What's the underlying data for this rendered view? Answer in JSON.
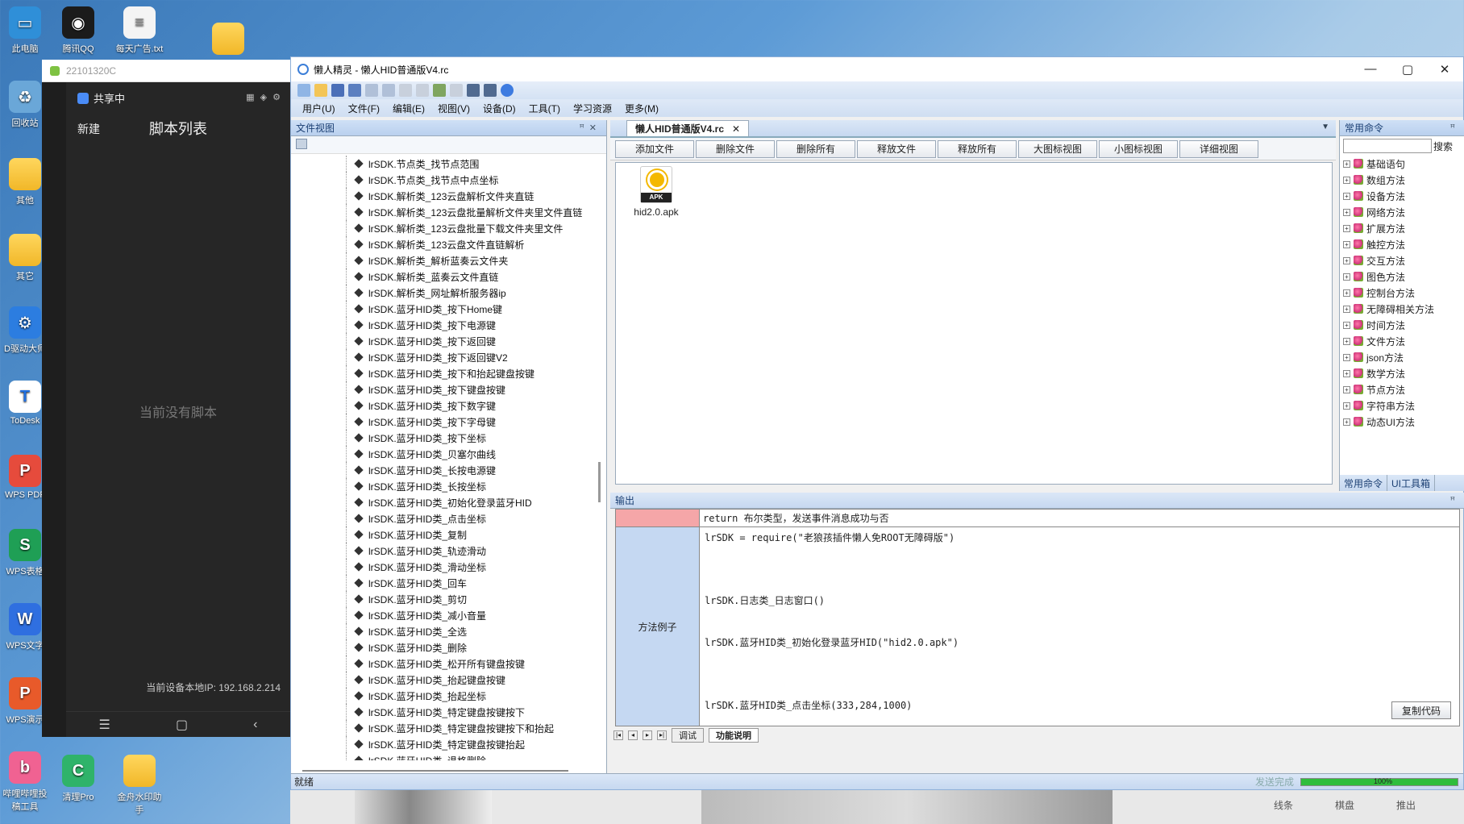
{
  "desktop": {
    "icons_left": [
      {
        "label": "此电脑"
      },
      {
        "label": "回收站"
      },
      {
        "label": "其他"
      },
      {
        "label": "其它"
      },
      {
        "label": "D驱动大师"
      },
      {
        "label": "ToDesk"
      },
      {
        "label": "WPS PDF"
      },
      {
        "label": "WPS表格"
      },
      {
        "label": "WPS文字"
      },
      {
        "label": "WPS演示"
      },
      {
        "label": "哔哩哔哩投稿工具"
      }
    ],
    "icons_top": [
      {
        "label": "腾讯QQ"
      },
      {
        "label": "每天广告.txt"
      }
    ],
    "icons_bottom": [
      {
        "label": "清理Pro"
      },
      {
        "label": "金舟水印助手"
      }
    ]
  },
  "phone": {
    "window_title": "22101320C",
    "share_status": "共享中",
    "new_label": "新建",
    "list_title": "脚本列表",
    "empty_text": "当前没有脚本",
    "ip_text": "当前设备本地IP: 192.168.2.214"
  },
  "app": {
    "title": "懒人精灵 - 懒人HID普通版V4.rc",
    "menu": [
      "用户(U)",
      "文件(F)",
      "编辑(E)",
      "视图(V)",
      "设备(D)",
      "工具(T)",
      "学习资源",
      "更多(M)"
    ],
    "file_view_title": "文件视图",
    "tree_items": [
      "lrSDK.节点类_找节点范围",
      "lrSDK.节点类_找节点中点坐标",
      "lrSDK.解析类_123云盘解析文件夹直链",
      "lrSDK.解析类_123云盘批量解析文件夹里文件直链",
      "lrSDK.解析类_123云盘批量下载文件夹里文件",
      "lrSDK.解析类_123云盘文件直链解析",
      "lrSDK.解析类_解析蓝奏云文件夹",
      "lrSDK.解析类_蓝奏云文件直链",
      "lrSDK.解析类_网址解析服务器ip",
      "lrSDK.蓝牙HID类_按下Home键",
      "lrSDK.蓝牙HID类_按下电源键",
      "lrSDK.蓝牙HID类_按下返回键",
      "lrSDK.蓝牙HID类_按下返回键V2",
      "lrSDK.蓝牙HID类_按下和抬起键盘按键",
      "lrSDK.蓝牙HID类_按下键盘按键",
      "lrSDK.蓝牙HID类_按下数字键",
      "lrSDK.蓝牙HID类_按下字母键",
      "lrSDK.蓝牙HID类_按下坐标",
      "lrSDK.蓝牙HID类_贝塞尔曲线",
      "lrSDK.蓝牙HID类_长按电源键",
      "lrSDK.蓝牙HID类_长按坐标",
      "lrSDK.蓝牙HID类_初始化登录蓝牙HID",
      "lrSDK.蓝牙HID类_点击坐标",
      "lrSDK.蓝牙HID类_复制",
      "lrSDK.蓝牙HID类_轨迹滑动",
      "lrSDK.蓝牙HID类_滑动坐标",
      "lrSDK.蓝牙HID类_回车",
      "lrSDK.蓝牙HID类_剪切",
      "lrSDK.蓝牙HID类_减小音量",
      "lrSDK.蓝牙HID类_全选",
      "lrSDK.蓝牙HID类_删除",
      "lrSDK.蓝牙HID类_松开所有键盘按键",
      "lrSDK.蓝牙HID类_抬起键盘按键",
      "lrSDK.蓝牙HID类_抬起坐标",
      "lrSDK.蓝牙HID类_特定键盘按键按下",
      "lrSDK.蓝牙HID类_特定键盘按键按下和抬起",
      "lrSDK.蓝牙HID类_特定键盘按键抬起",
      "lrSDK.蓝牙HID类_退格删除"
    ],
    "doc_tab": "懒人HID普通版V4.rc",
    "file_buttons": [
      "添加文件",
      "删除文件",
      "删除所有",
      "释放文件",
      "释放所有",
      "大图标视图",
      "小图标视图",
      "详细视图"
    ],
    "file_item": {
      "name": "hid2.0.apk",
      "badge": "APK"
    },
    "cmd_title": "常用命令",
    "cmd_search": "搜索",
    "commands": [
      "基础语句",
      "数组方法",
      "设备方法",
      "网络方法",
      "扩展方法",
      "触控方法",
      "交互方法",
      "图色方法",
      "控制台方法",
      "无障碍相关方法",
      "时间方法",
      "文件方法",
      "json方法",
      "数学方法",
      "节点方法",
      "字符串方法",
      "动态UI方法"
    ],
    "cmd_tabs": [
      "常用命令",
      "UI工具箱"
    ],
    "output_title": "输出",
    "output_return": "return 布尔类型，发送事件消息成功与否",
    "output_label": "方法例子",
    "output_code": [
      "lrSDK = require(\"老狼孩插件懒人免ROOT无障碍版\")",
      "lrSDK.日志类_日志窗口()",
      "lrSDK.蓝牙HID类_初始化登录蓝牙HID(\"hid2.0.apk\")",
      "lrSDK.蓝牙HID类_点击坐标(333,284,1000)"
    ],
    "copy_button": "复制代码",
    "bottom_tabs": [
      "调试",
      "功能说明"
    ],
    "status_left": "就绪",
    "status_send": "发送完成",
    "progress_pct": "100%",
    "progress_value": 1.0,
    "strip_labels": [
      "线条",
      "棋盘",
      "推出"
    ]
  }
}
